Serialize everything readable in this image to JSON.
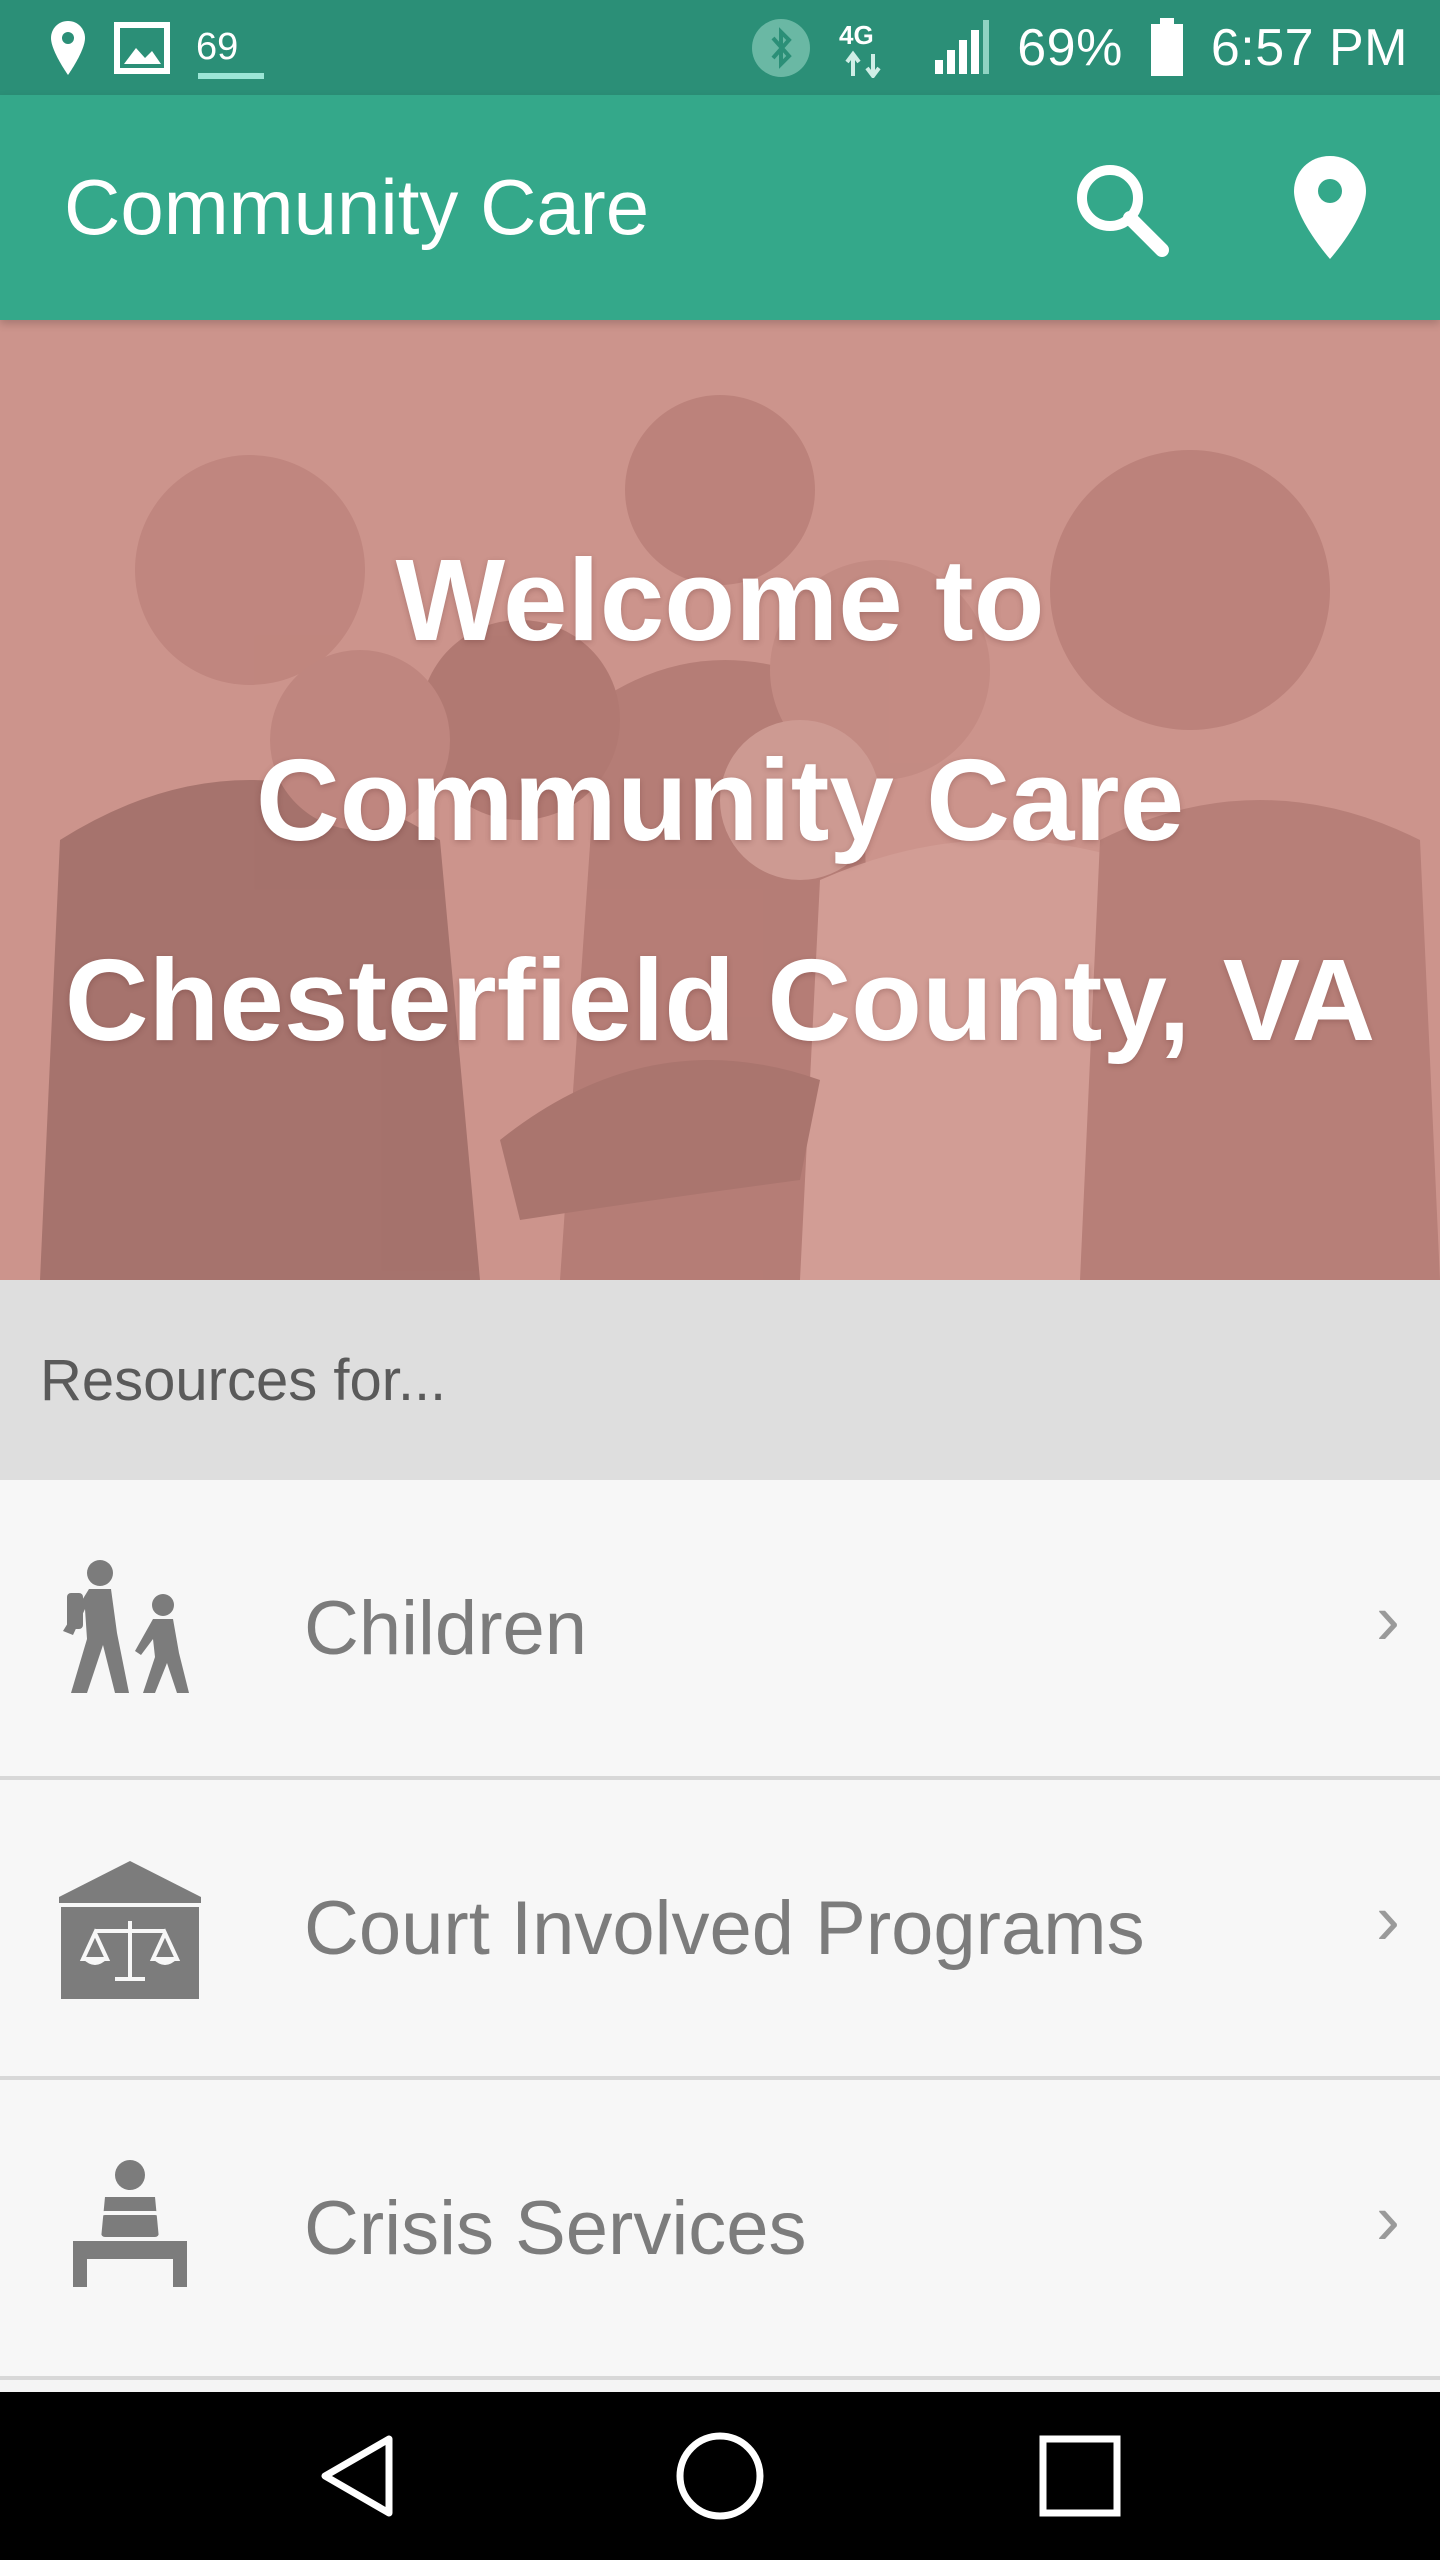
{
  "status_bar": {
    "notification_count": "69",
    "network": "4G",
    "battery": "69%",
    "time": "6:57 PM"
  },
  "app_bar": {
    "title": "Community Care",
    "actions": [
      {
        "name": "search",
        "icon": "search-icon"
      },
      {
        "name": "map",
        "icon": "location-pin-icon"
      }
    ]
  },
  "hero": {
    "line1": "Welcome to",
    "line2": "Community Care",
    "line3": "Chesterfield County, VA"
  },
  "resources": {
    "header": "Resources for...",
    "items": [
      {
        "label": "Children",
        "icon": "children-walking-icon"
      },
      {
        "label": "Court Involved Programs",
        "icon": "courthouse-scales-icon"
      },
      {
        "label": "Crisis Services",
        "icon": "crisis-person-icon"
      }
    ]
  },
  "nav_bar": {
    "buttons": [
      "back-icon",
      "home-icon",
      "recents-icon"
    ]
  },
  "colors": {
    "status_bar": "#2b8f77",
    "app_bar": "#34a88a",
    "hero_tint": "#c9948c",
    "section_header": "#dedede",
    "list_background": "#f7f7f7",
    "icon_gray": "#7c7c7c"
  }
}
